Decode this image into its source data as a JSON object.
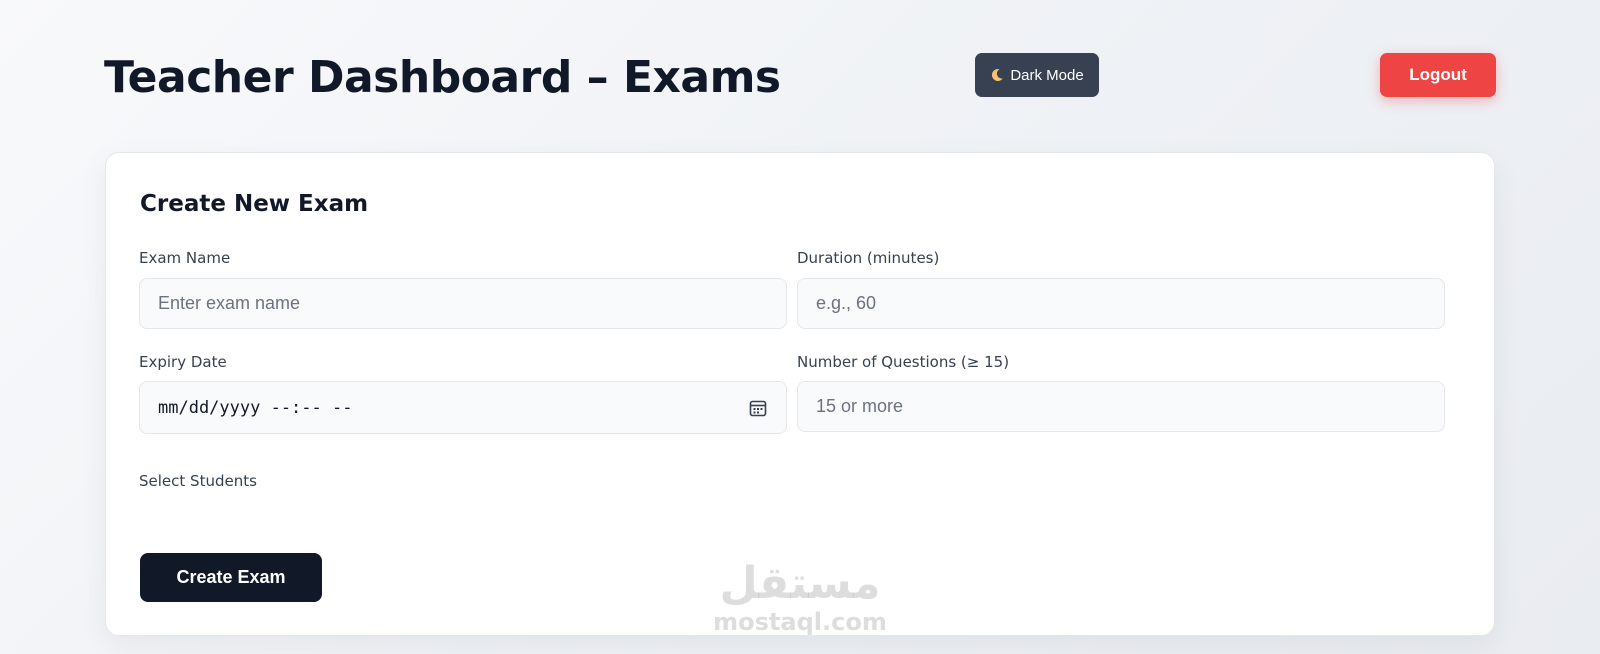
{
  "header": {
    "title": "Teacher Dashboard – Exams",
    "dark_mode_label": "Dark Mode",
    "dark_mode_icon": "moon-icon",
    "logout_label": "Logout"
  },
  "form": {
    "title": "Create New Exam",
    "exam_name": {
      "label": "Exam Name",
      "placeholder": "Enter exam name",
      "value": ""
    },
    "duration": {
      "label": "Duration (minutes)",
      "placeholder": "e.g., 60",
      "value": ""
    },
    "expiry_date": {
      "label": "Expiry Date",
      "display": "mm/dd/yyyy --:-- --",
      "icon": "calendar-icon"
    },
    "num_questions": {
      "label": "Number of Questions (≥ 15)",
      "placeholder": "15 or more",
      "value": ""
    },
    "students": {
      "label": "Select Students"
    },
    "submit_label": "Create Exam"
  },
  "watermark": {
    "arabic": "مستقل",
    "latin": "mostaql.com"
  },
  "colors": {
    "primary_dark": "#111827",
    "logout_red": "#ef4444",
    "dark_mode_btn": "#374151",
    "input_bg": "#f9fafb",
    "input_border": "#e5e7eb"
  }
}
